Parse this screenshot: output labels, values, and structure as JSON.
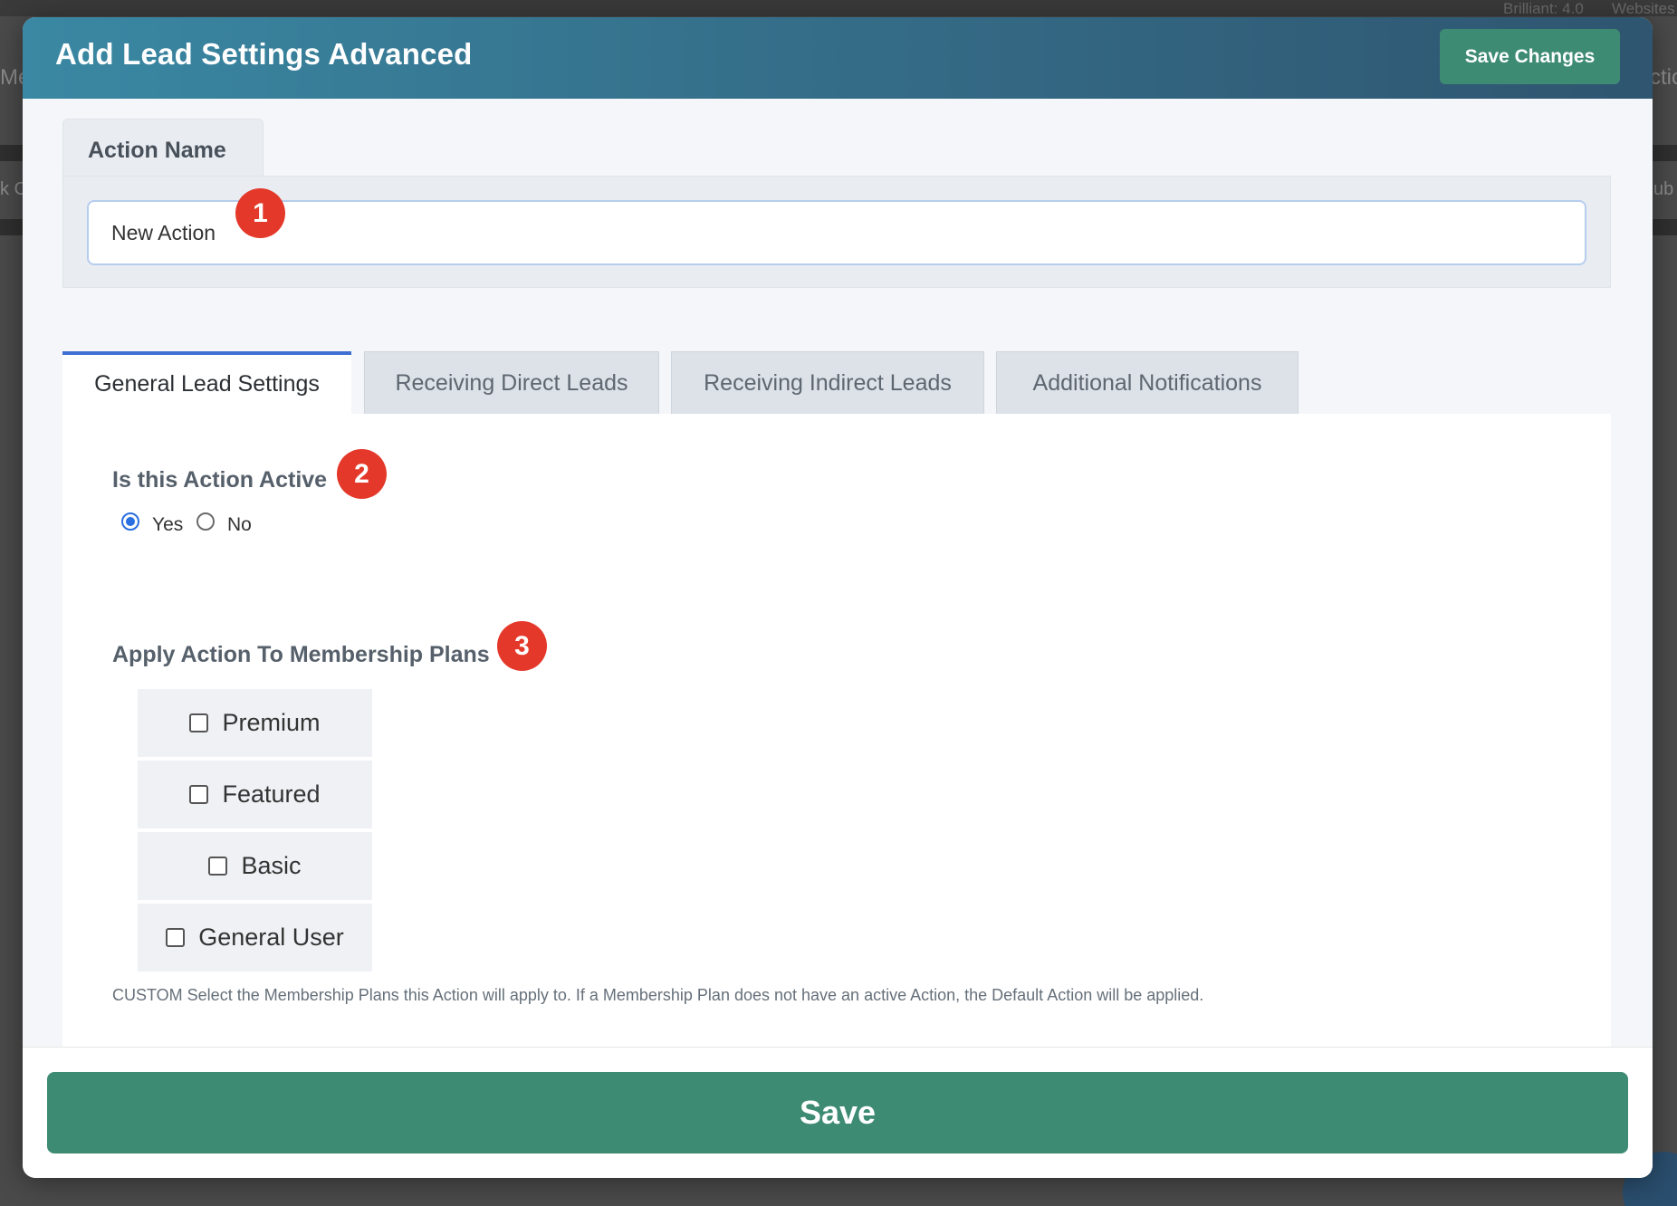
{
  "background": {
    "top_left_text": "Brilliant: 4.0",
    "top_right_text": "Websites",
    "left_fragment_1": "Me",
    "left_fragment_2": "k C",
    "right_fragment_1": "ctio",
    "right_fragment_2": "ub"
  },
  "modal": {
    "title": "Add Lead Settings Advanced",
    "header_save_label": "Save Changes",
    "action_name": {
      "label": "Action Name",
      "value": "New Action"
    },
    "tabs": [
      {
        "label": "General Lead Settings",
        "active": true
      },
      {
        "label": "Receiving Direct Leads",
        "active": false
      },
      {
        "label": "Receiving Indirect Leads",
        "active": false
      },
      {
        "label": "Additional Notifications",
        "active": false
      }
    ],
    "active_section": {
      "label": "Is this Action Active",
      "options": [
        {
          "label": "Yes",
          "checked": true
        },
        {
          "label": "No",
          "checked": false
        }
      ]
    },
    "membership_section": {
      "label": "Apply Action To Membership Plans",
      "plans": [
        {
          "label": "Premium",
          "checked": false
        },
        {
          "label": "Featured",
          "checked": false
        },
        {
          "label": "Basic",
          "checked": false
        },
        {
          "label": "General User",
          "checked": false
        }
      ],
      "help_text": "CUSTOM Select the Membership Plans this Action will apply to. If a Membership Plan does not have an active Action, the Default Action will be applied."
    },
    "footer_save_label": "Save"
  },
  "markers": [
    "1",
    "2",
    "3"
  ],
  "colors": {
    "header_gradient_start": "#3a88a3",
    "header_gradient_end": "#2f5570",
    "save_button": "#3e8b73",
    "active_tab_border": "#3f6fd3",
    "marker": "#e4392a",
    "radio_checked": "#2a6fe0"
  }
}
